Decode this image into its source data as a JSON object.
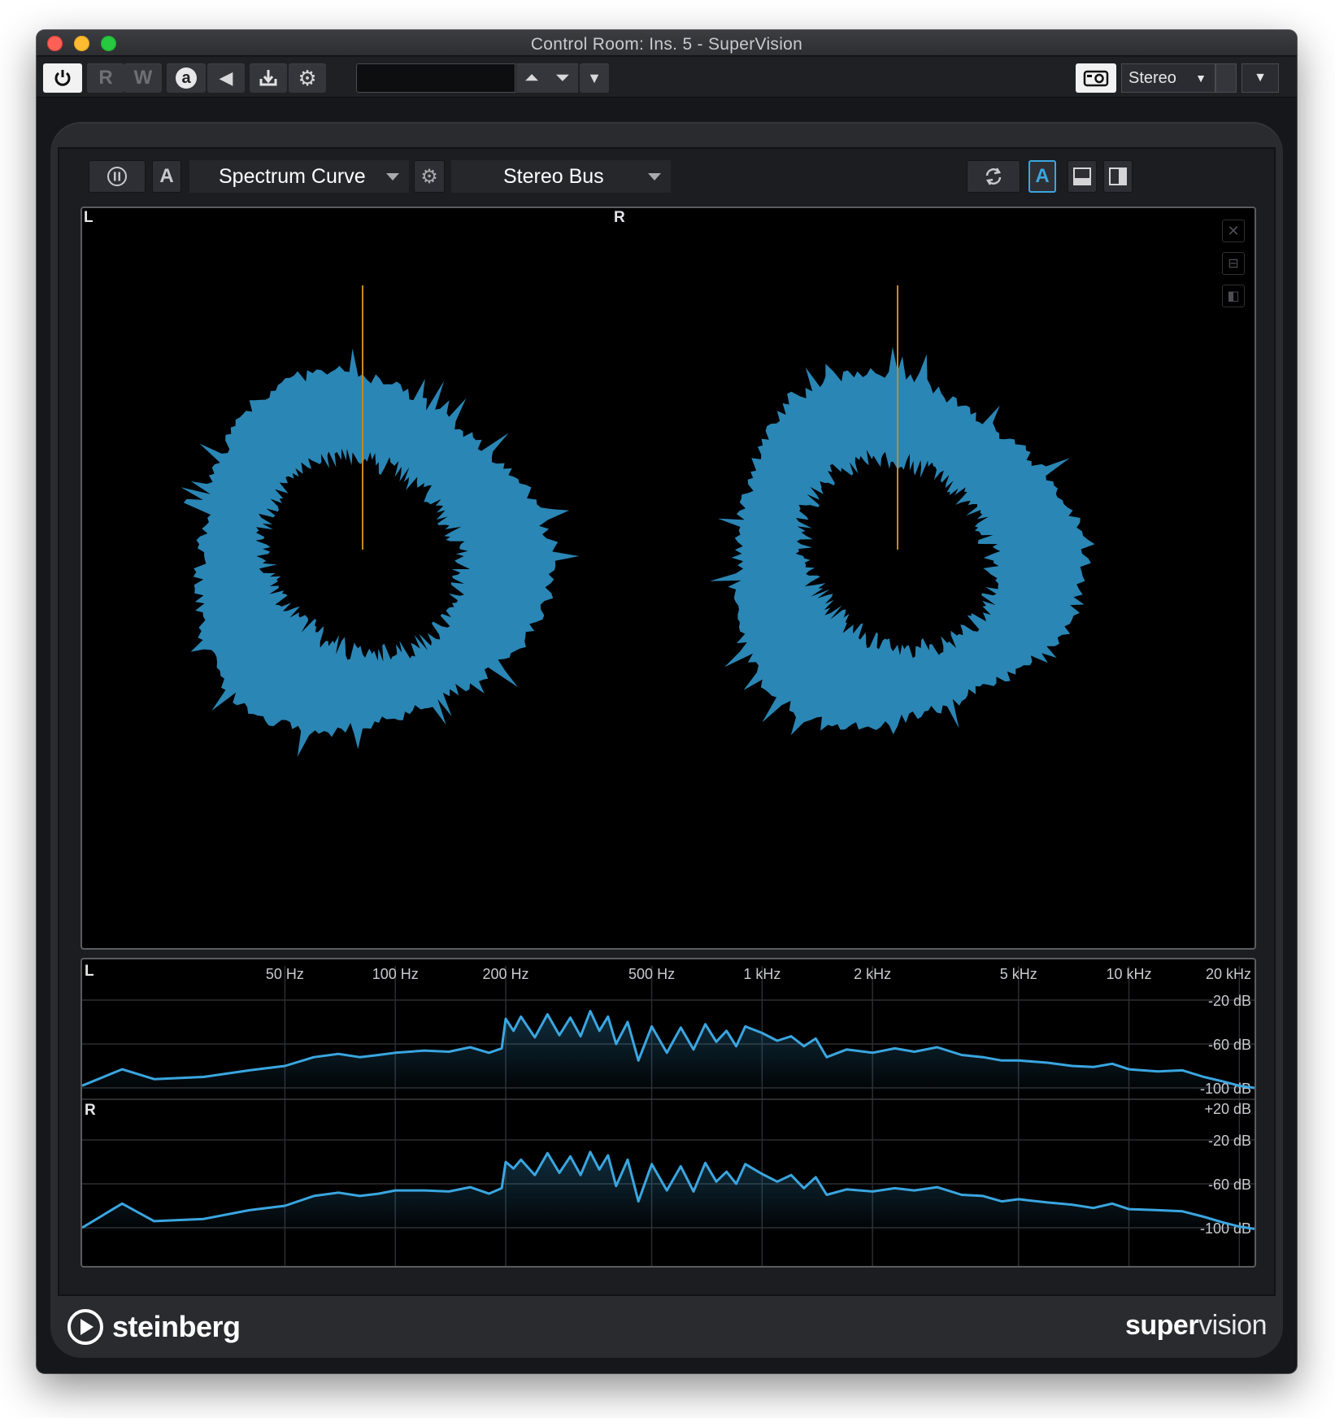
{
  "window": {
    "title": "Control Room: Ins. 5 - SuperVision"
  },
  "toolbar": {
    "read_label": "R",
    "write_label": "W",
    "auto_label": "a",
    "preset_name": "",
    "channel_config": "Stereo"
  },
  "module_bar": {
    "module_name": "Spectrum Curve",
    "bus_name": "Stereo Bus",
    "analysis_label": "A",
    "auto_label": "A"
  },
  "vectorscope": {
    "left_label": "L",
    "right_label": "R",
    "color": "#2a86b5",
    "needle_color": "#c68a1c"
  },
  "spectrum": {
    "chart_data": {
      "type": "line",
      "x_unit": "Hz",
      "x_scale": "log",
      "xlim": [
        14,
        22000
      ],
      "ylim": [
        -110,
        20
      ],
      "freq_ticks": [
        {
          "hz": 50,
          "label": "50 Hz"
        },
        {
          "hz": 100,
          "label": "100 Hz"
        },
        {
          "hz": 200,
          "label": "200 Hz"
        },
        {
          "hz": 500,
          "label": "500 Hz"
        },
        {
          "hz": 1000,
          "label": "1 kHz"
        },
        {
          "hz": 2000,
          "label": "2 kHz"
        },
        {
          "hz": 5000,
          "label": "5 kHz"
        },
        {
          "hz": 10000,
          "label": "10 kHz"
        },
        {
          "hz": 20000,
          "label": "20 kHz"
        }
      ],
      "db_ticks": [
        {
          "db": 20,
          "label": "+20 dB"
        },
        {
          "db": -20,
          "label": "-20 dB"
        },
        {
          "db": -60,
          "label": "-60 dB"
        },
        {
          "db": -100,
          "label": "-100 dB"
        }
      ],
      "series": [
        {
          "name": "L",
          "color": "#3aa6e0",
          "x": [
            14,
            18,
            22,
            30,
            40,
            50,
            60,
            70,
            80,
            90,
            100,
            120,
            140,
            160,
            180,
            195,
            200,
            210,
            220,
            240,
            260,
            280,
            300,
            320,
            340,
            360,
            380,
            400,
            430,
            460,
            500,
            550,
            600,
            650,
            700,
            750,
            800,
            850,
            900,
            1000,
            1100,
            1200,
            1300,
            1400,
            1500,
            1700,
            2000,
            2300,
            2600,
            3000,
            3500,
            4000,
            4500,
            5000,
            6000,
            7000,
            8000,
            9000,
            10000,
            12000,
            14000,
            16000,
            18000,
            20000,
            22000
          ],
          "y": [
            -98,
            -83,
            -92,
            -90,
            -84,
            -80,
            -72,
            -69,
            -72,
            -70,
            -68,
            -66,
            -67,
            -63,
            -68,
            -64,
            -37,
            -48,
            -35,
            -54,
            -33,
            -52,
            -36,
            -53,
            -30,
            -48,
            -35,
            -60,
            -40,
            -75,
            -44,
            -68,
            -45,
            -65,
            -42,
            -58,
            -48,
            -62,
            -44,
            -50,
            -57,
            -53,
            -62,
            -55,
            -72,
            -65,
            -68,
            -64,
            -67,
            -63,
            -70,
            -72,
            -75,
            -75,
            -77,
            -80,
            -81,
            -78,
            -83,
            -85,
            -84,
            -90,
            -94,
            -98,
            -100
          ]
        },
        {
          "name": "R",
          "color": "#3aa6e0",
          "x": [
            14,
            18,
            22,
            30,
            40,
            50,
            60,
            70,
            80,
            90,
            100,
            120,
            140,
            160,
            180,
            195,
            200,
            210,
            220,
            240,
            260,
            280,
            300,
            320,
            340,
            360,
            380,
            400,
            430,
            460,
            500,
            550,
            600,
            650,
            700,
            750,
            800,
            850,
            900,
            1000,
            1100,
            1200,
            1300,
            1400,
            1500,
            1700,
            2000,
            2300,
            2600,
            3000,
            3500,
            4000,
            4500,
            5000,
            6000,
            7000,
            8000,
            9000,
            10000,
            12000,
            14000,
            16000,
            18000,
            20000,
            22000
          ],
          "y": [
            -100,
            -78,
            -94,
            -92,
            -84,
            -80,
            -71,
            -68,
            -71,
            -69,
            -66,
            -66,
            -67,
            -63,
            -69,
            -64,
            -40,
            -46,
            -38,
            -52,
            -32,
            -50,
            -35,
            -52,
            -31,
            -47,
            -34,
            -62,
            -38,
            -76,
            -42,
            -66,
            -44,
            -67,
            -41,
            -58,
            -49,
            -60,
            -42,
            -51,
            -58,
            -52,
            -64,
            -54,
            -70,
            -65,
            -67,
            -64,
            -66,
            -63,
            -70,
            -71,
            -76,
            -74,
            -77,
            -79,
            -82,
            -78,
            -83,
            -84,
            -85,
            -90,
            -95,
            -99,
            -101
          ]
        }
      ]
    }
  },
  "footer": {
    "brand_left": "steinberg",
    "brand_right_bold": "super",
    "brand_right_light": "vision"
  }
}
